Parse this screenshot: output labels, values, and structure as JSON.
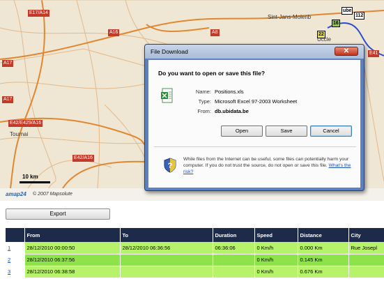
{
  "map": {
    "road_labels": [
      "E17/A14",
      "A8",
      "A16",
      "E42/E429/A16",
      "A17",
      "E42/A16",
      "E41",
      "A17"
    ],
    "places": [
      "Sint-Jans-Molenb",
      "Tournai",
      "Uccle"
    ],
    "markers": [
      "112",
      "16",
      "22",
      "ube"
    ],
    "scale_label": "10 km",
    "logo": "amap24",
    "copyright": "© 2007 Mapsolute"
  },
  "toolbar": {
    "export_label": "Export"
  },
  "table": {
    "headers": [
      "",
      "From",
      "To",
      "Duration",
      "Speed",
      "Distance",
      "City"
    ],
    "rows": [
      [
        "1",
        "28/12/2010 00:00:50",
        "28/12/2010 06:36:56",
        "06:36:06",
        "0 Km/h",
        "0.000 Km",
        "Rue Josepl"
      ],
      [
        "2",
        "28/12/2010 06:37:56",
        "",
        "",
        "0 Km/h",
        "0.145 Km",
        ""
      ],
      [
        "3",
        "28/12/2010 06:38:58",
        "",
        "",
        "0 Km/h",
        "0.676 Km",
        ""
      ]
    ]
  },
  "dialog": {
    "title": "File Download",
    "close_label": "✕",
    "question": "Do you want to open or save this file?",
    "name_label": "Name:",
    "name_value": "Positions.xls",
    "type_label": "Type:",
    "type_value": "Microsoft Excel 97-2003 Worksheet",
    "from_label": "From:",
    "from_value": "db.ubidata.be",
    "open_label": "Open",
    "save_label": "Save",
    "cancel_label": "Cancel",
    "warning_text": "While files from the Internet can be useful, some files can potentially harm your computer. If you do not trust the source, do not open or save this file.",
    "risk_link": "What's the risk?"
  },
  "colors": {
    "table_header_bg": "#1d2a4a",
    "row_light": "#b7f36a",
    "row_dark": "#8fe34a",
    "dialog_frame": "#5b7fbf",
    "map_bg": "#efe6d4"
  }
}
